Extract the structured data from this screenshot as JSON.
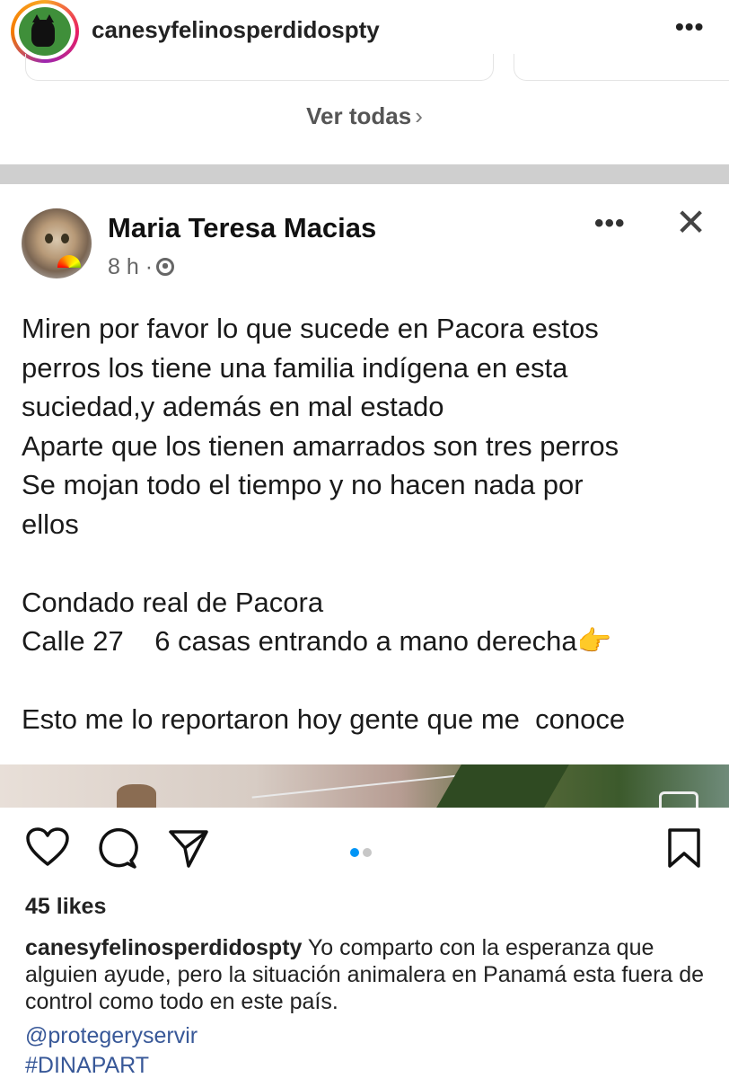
{
  "header": {
    "username": "canesyfelinosperdidospty",
    "more_label": "•••"
  },
  "see_all": {
    "label": "Ver todas",
    "chevron": "›"
  },
  "post": {
    "author": "Maria Teresa Macias",
    "time": "8 h ·",
    "more_label": "•••",
    "close_label": "✕",
    "lines": [
      "Miren por favor lo que sucede en Pacora estos",
      "perros los tiene una familia indígena en esta",
      "suciedad,y además en mal estado",
      "Aparte que los tienen amarrados son tres perros",
      "Se mojan todo el tiempo y no hacen nada por",
      "ellos",
      "",
      "Condado real de Pacora",
      "Calle 27    6 casas entrando a mano derecha👉",
      "",
      "Esto me lo reportaron hoy gente que me  conoce"
    ]
  },
  "actions": {
    "icons": [
      "heart-icon",
      "comment-icon",
      "share-icon",
      "bookmark-icon"
    ],
    "carousel": {
      "total": 2,
      "active": 1
    }
  },
  "likes": "45 likes",
  "caption": {
    "user": "canesyfelinosperdidospty",
    "text": " Yo comparto con la esperanza que alguien ayude, pero la situación animalera en Panamá esta fuera de control como todo en este país."
  },
  "tags": {
    "mention": "@protegeryservir",
    "hashtag": "#DINAPART"
  },
  "colors": {
    "link": "#385898",
    "carousel_active": "#0095f6",
    "carousel_inactive": "#c7c7c7",
    "band": "#cfcfcf"
  }
}
